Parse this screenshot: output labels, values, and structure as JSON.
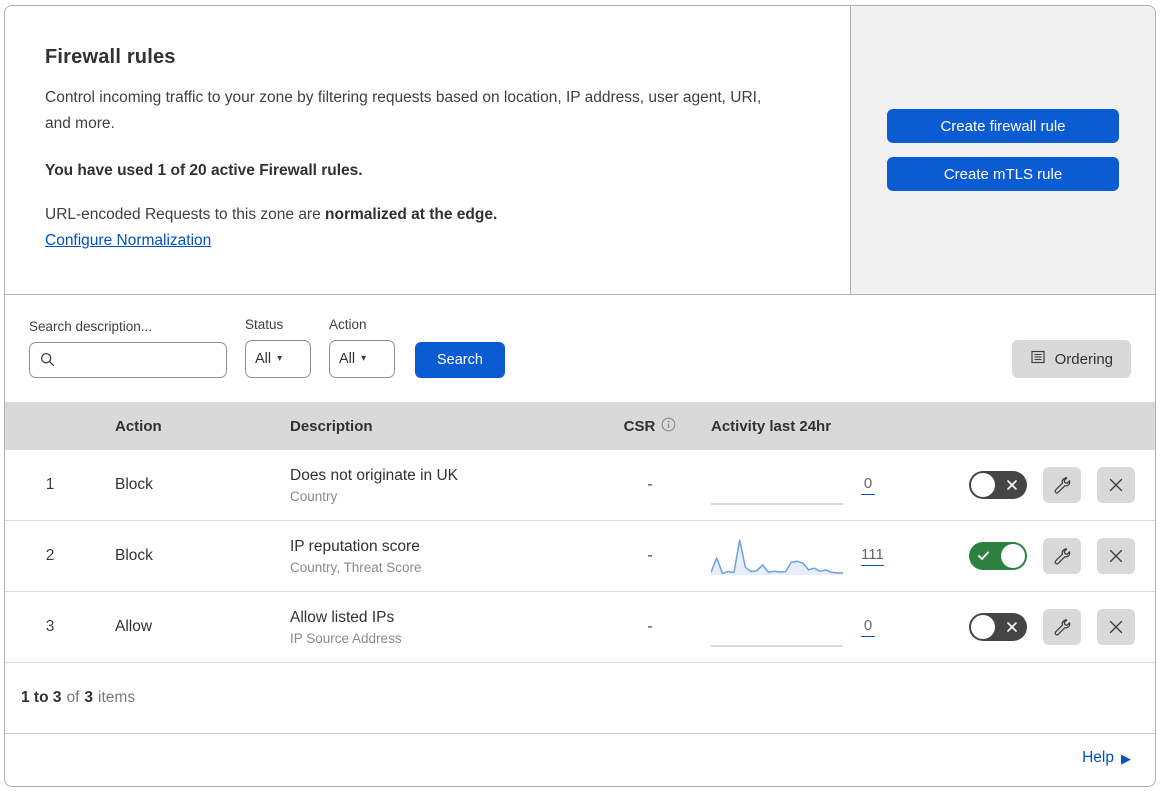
{
  "colors": {
    "accent_blue": "#0b5bd3",
    "link_blue": "#0051c3",
    "toggle_on_green": "#2c8140",
    "toggle_off_gray": "#454545",
    "sparkline_blue": "#6fa1dd",
    "table_header_gray": "#d9d9d9",
    "side_panel_gray": "#f1f1f1"
  },
  "header": {
    "title": "Firewall rules",
    "description": "Control incoming traffic to your zone by filtering requests based on location, IP address, user agent, URI, and more.",
    "usage_note": "You have used 1 of 20 active Firewall rules.",
    "normalization_prefix": "URL-encoded Requests to this zone are ",
    "normalization_bold": "normalized at the edge.",
    "normalization_link": "Configure Normalization",
    "buttons": {
      "create_firewall": "Create firewall rule",
      "create_mtls": "Create mTLS rule"
    }
  },
  "filters": {
    "search_label": "Search description...",
    "search_value": "",
    "status_label": "Status",
    "status_value": "All",
    "action_label": "Action",
    "action_value": "All",
    "search_button": "Search",
    "ordering_button": "Ordering"
  },
  "table": {
    "columns": {
      "action": "Action",
      "description": "Description",
      "csr": "CSR",
      "activity": "Activity last 24hr"
    },
    "rows": [
      {
        "priority": "1",
        "action": "Block",
        "description": "Does not originate in UK",
        "fields": "Country",
        "csr": "-",
        "activity_count": "0",
        "enabled": false
      },
      {
        "priority": "2",
        "action": "Block",
        "description": "IP reputation score",
        "fields": "Country, Threat Score",
        "csr": "-",
        "activity_count": "111",
        "enabled": true
      },
      {
        "priority": "3",
        "action": "Allow",
        "description": "Allow listed IPs",
        "fields": "IP Source Address",
        "csr": "-",
        "activity_count": "0",
        "enabled": false
      }
    ]
  },
  "footer": {
    "range_bold": "1 to 3",
    "of_text": "of",
    "total_bold": "3",
    "items_text": "items"
  },
  "help": {
    "label": "Help",
    "arrow_icon": "▶"
  },
  "icons": {
    "caret_down": "▾"
  },
  "chart_data": {
    "type": "line",
    "title": "Activity last 24hr sparklines",
    "xlabel": "last 24 hours",
    "grid": false,
    "legend": false,
    "series": [
      {
        "name": "Does not originate in UK",
        "total": 0,
        "values": [
          0,
          0,
          0,
          0,
          0,
          0,
          0,
          0,
          0,
          0,
          0,
          0,
          0,
          0,
          0,
          0,
          0,
          0,
          0,
          0,
          0,
          0,
          0,
          0
        ]
      },
      {
        "name": "IP reputation score",
        "total": 111,
        "values": [
          6,
          40,
          4,
          8,
          6,
          82,
          18,
          8,
          10,
          24,
          6,
          9,
          7,
          8,
          30,
          32,
          28,
          12,
          16,
          9,
          12,
          6,
          5,
          5
        ]
      },
      {
        "name": "Allow listed IPs",
        "total": 0,
        "values": [
          0,
          0,
          0,
          0,
          0,
          0,
          0,
          0,
          0,
          0,
          0,
          0,
          0,
          0,
          0,
          0,
          0,
          0,
          0,
          0,
          0,
          0,
          0,
          0
        ]
      }
    ]
  }
}
